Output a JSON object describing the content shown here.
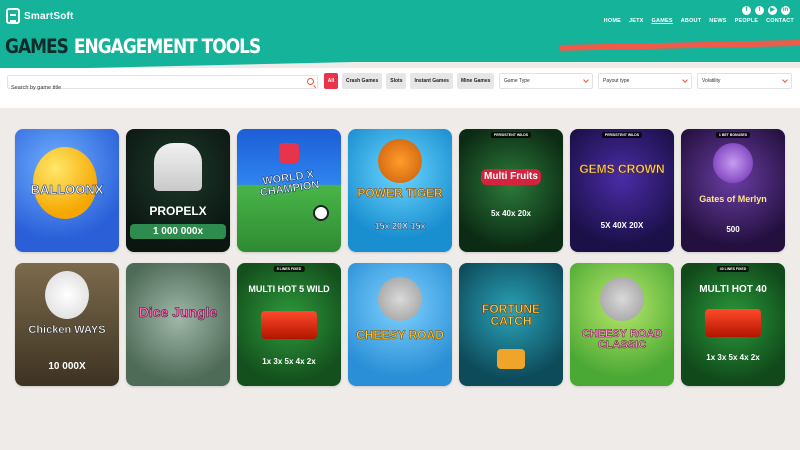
{
  "brand": {
    "name": "SmartSoft"
  },
  "social": [
    "f",
    "t",
    "▶",
    "in"
  ],
  "nav": [
    {
      "label": "HOME"
    },
    {
      "label": "JETX"
    },
    {
      "label": "GAMES"
    },
    {
      "label": "ABOUT"
    },
    {
      "label": "NEWS"
    },
    {
      "label": "PEOPLE"
    },
    {
      "label": "CONTACT"
    }
  ],
  "section_tabs": [
    {
      "label": "GAMES"
    },
    {
      "label": "ENGAGEMENT TOOLS"
    }
  ],
  "filters": {
    "search_placeholder": "Search by game title",
    "chips": [
      {
        "label": "All"
      },
      {
        "label": "Crash Games"
      },
      {
        "label": "Slots"
      },
      {
        "label": "Instant Games"
      },
      {
        "label": "Mine Games"
      }
    ],
    "dropdowns": [
      {
        "label": "Game Type"
      },
      {
        "label": "Payout type"
      },
      {
        "label": "Volatility"
      }
    ]
  },
  "colors": {
    "brand": "#14b39a",
    "accent": "#e8344a",
    "dark": "#0f2c2a"
  },
  "games": [
    {
      "title": "BALLOONX",
      "sub": "",
      "badge": ""
    },
    {
      "title": "PROPELX",
      "sub": "1 000 000x",
      "badge": ""
    },
    {
      "title": "WORLD X CHAMPION",
      "sub": "",
      "badge": ""
    },
    {
      "title": "POWER TIGER",
      "sub": "15x 20X 15x",
      "badge": ""
    },
    {
      "title": "Multi Fruits",
      "sub": "5x 40x 20x",
      "badge": "PERSISTENT WILDS"
    },
    {
      "title": "GEMS CROWN",
      "sub": "5X 40X 20X",
      "badge": "PERSISTENT WILDS"
    },
    {
      "title": "Gates of Merlyn",
      "sub": "500",
      "badge": "1 BET BONUSES"
    },
    {
      "title": "Chicken WAYS",
      "sub": "10 000X",
      "badge": ""
    },
    {
      "title": "Dice Jungle",
      "sub": "",
      "badge": ""
    },
    {
      "title": "MULTI HOT 5 WILD",
      "sub": "1x 3x 5x 4x 2x",
      "badge": "5 LINES FIXED"
    },
    {
      "title": "CHEESY ROAD",
      "sub": "",
      "badge": ""
    },
    {
      "title": "FORTUNE CATCH",
      "sub": "",
      "badge": ""
    },
    {
      "title": "CHEESY ROAD CLASSIC",
      "sub": "",
      "badge": ""
    },
    {
      "title": "MULTI HOT 40",
      "sub": "1x 3x 5x 4x 2x",
      "badge": "40 LINES FIXED"
    }
  ]
}
